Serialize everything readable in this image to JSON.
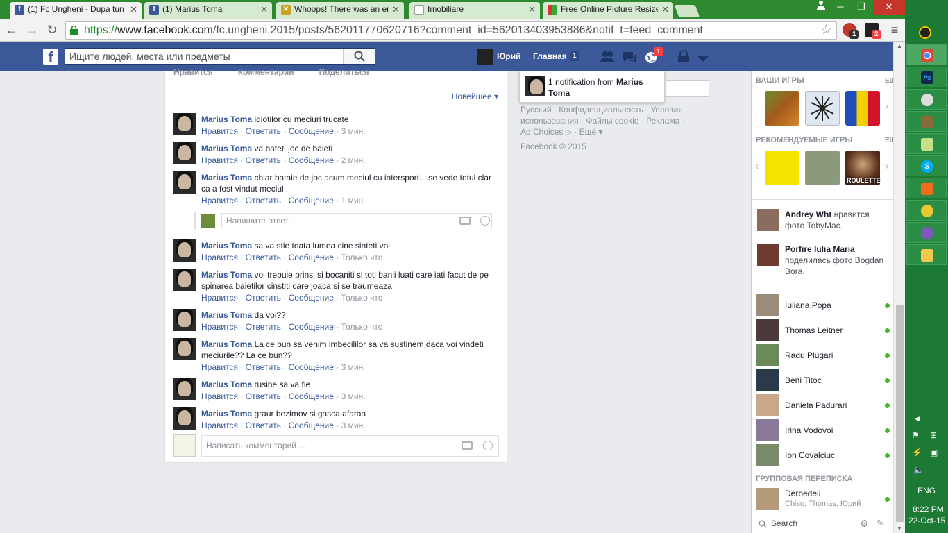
{
  "browser": {
    "tabs": [
      {
        "label": "(1) Fc Ungheni - Dupa tun",
        "icon": "facebook-icon",
        "active": true
      },
      {
        "label": "(1) Marius Toma",
        "icon": "facebook-icon",
        "active": false
      },
      {
        "label": "Whoops! There was an err",
        "icon": "laravel-icon",
        "active": false
      },
      {
        "label": "Imobiliare",
        "icon": "document-icon",
        "active": false
      },
      {
        "label": "Free Online Picture Resize",
        "icon": "grid-icon",
        "active": false
      }
    ],
    "url_prefix": "https://",
    "url_host": "www.facebook.com",
    "url_path": "/fc.ungheni.2015/posts/562011770620716?comment_id=562013403953886&notif_t=feed_comment",
    "ext_badges": [
      "1",
      "2"
    ]
  },
  "fb": {
    "search_placeholder": "Ищите людей, места или предметы",
    "user_name": "Юрий",
    "home_label": "Главная",
    "home_count": "1",
    "notif_count": "1"
  },
  "post": {
    "actions": [
      "Нравится",
      "Комментарии",
      "Поделиться"
    ],
    "sort_label": "Новейшее",
    "comment_meta": {
      "like": "Нравится",
      "reply": "Ответить",
      "message": "Сообщение"
    },
    "comments": [
      {
        "author": "Marius Toma",
        "text": "idiotilor cu meciuri trucate",
        "time": "3 мин."
      },
      {
        "author": "Marius Toma",
        "text": "va bateti joc de baieti",
        "time": "2 мин."
      },
      {
        "author": "Marius Toma",
        "text": "chiar bataie de joc acum meciul cu intersport....se vede totul clar ca a fost vindut meciul",
        "time": "1 мин."
      },
      {
        "author": "Marius Toma",
        "text": "sa va stie toata lumea cine sinteti voi",
        "time": "Только что"
      },
      {
        "author": "Marius Toma",
        "text": "voi trebuie prinsi si bocaniti si toti banii luati care iati facut de pe spinarea baietilor cinstiti care joaca si se traumeaza",
        "time": "Только что"
      },
      {
        "author": "Marius Toma",
        "text": "da voi??",
        "time": "Только что"
      },
      {
        "author": "Marius Toma",
        "text": "La ce bun sa venim imbecililor sa va sustinem daca voi vindeti meciurile?? La ce bun??",
        "time": "3 мин."
      },
      {
        "author": "Marius Toma",
        "text": "rusine sa va fie",
        "time": "3 мин."
      },
      {
        "author": "Marius Toma",
        "text": "graur bezimov si gasca afaraa",
        "time": "3 мин."
      }
    ],
    "reply_placeholder": "Напишите ответ...",
    "comment_placeholder": "Написать комментарий ..."
  },
  "notification": {
    "text": "1 notification from ",
    "from": "Marius Toma"
  },
  "footer": {
    "line1": [
      "Русский",
      "Конфиденциальность",
      "Условия"
    ],
    "line2": [
      "использования",
      "Файлы cookie",
      "Реклама"
    ],
    "line3": [
      "Ad Choices",
      "Ещё"
    ],
    "copyright": "Facebook © 2015"
  },
  "sidebar": {
    "your_games": "ВАШИ ИГРЫ",
    "more": "ЕЩЁ",
    "recommended_games": "РЕКОМЕНДУЕМЫЕ ИГРЫ",
    "game_label": "ROULETTE",
    "activity": [
      {
        "name": "Andrey Wht",
        "text": " нравится фото TobyMac."
      },
      {
        "name": "Porfire Iulia Maria",
        "text": " поделилась фото Bogdan Bora."
      }
    ],
    "friends": [
      "Iuliana Popa",
      "Thomas Leitner",
      "Radu Plugari",
      "Beni Titoc",
      "Daniela Padurari",
      "Irina Vodovoi",
      "Ion Covalciuc"
    ],
    "group_header": "ГРУППОВАЯ ПЕРЕПИСКА",
    "group": {
      "name": "Derbedeii",
      "members": "Chiso, Thomas, Юрий"
    },
    "search_label": "Search"
  },
  "taskbar": {
    "lang": "ENG",
    "time": "8:22 PM",
    "date": "22-Oct-15"
  },
  "colors": {
    "fb_blue": "#3b5998",
    "link": "#365899",
    "chrome_green": "#2e8a2f",
    "online": "#42b72a"
  }
}
